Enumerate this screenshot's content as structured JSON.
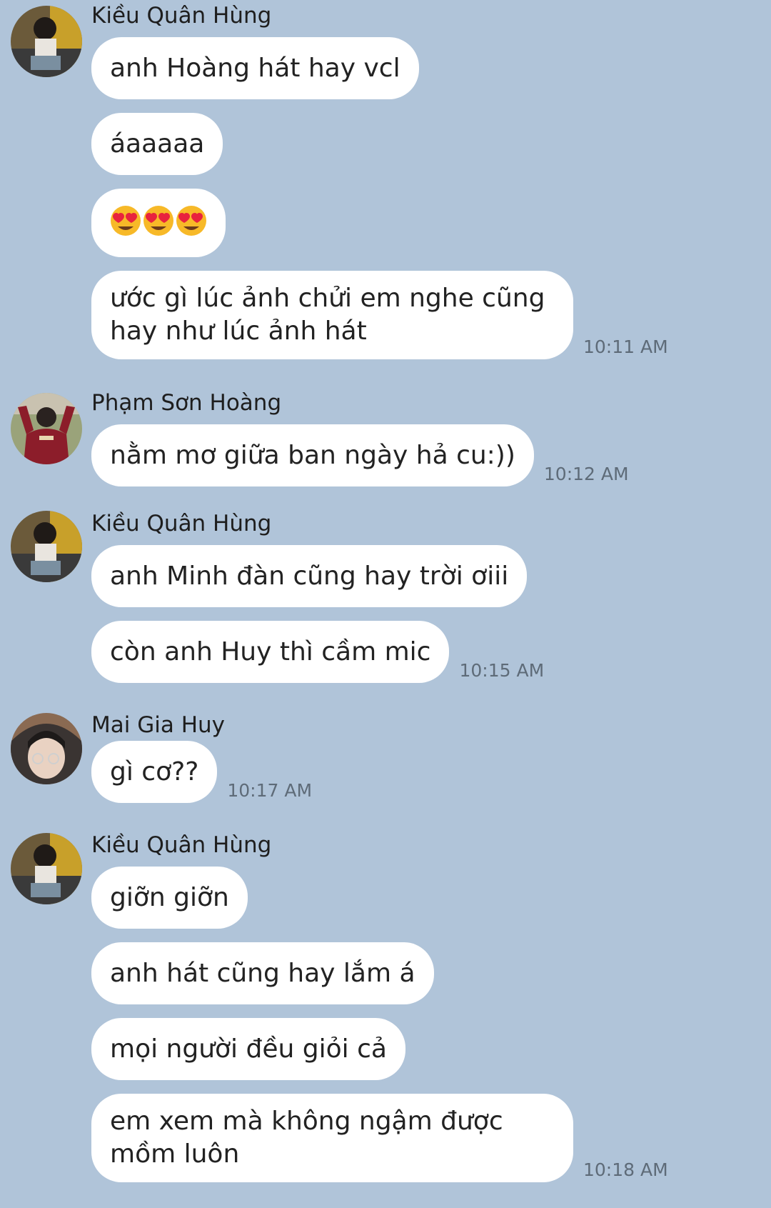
{
  "chat": {
    "groups": [
      {
        "sender": "Kiều Quân Hùng",
        "avatar_icon": "avatar-kieu-quan-hung",
        "messages": [
          {
            "text": "anh Hoàng hát hay vcl"
          },
          {
            "text": "áaaaaa"
          },
          {
            "emoji": [
              "heart-eyes-emoji",
              "heart-eyes-emoji",
              "heart-eyes-emoji"
            ]
          },
          {
            "text": "ước gì lúc ảnh chửi em nghe cũng hay như lúc ảnh hát",
            "time": "10:11 AM"
          }
        ]
      },
      {
        "sender": "Phạm Sơn Hoàng",
        "avatar_icon": "avatar-pham-son-hoang",
        "messages": [
          {
            "text": "nằm mơ giữa ban ngày hả cu:))",
            "time": "10:12 AM"
          }
        ]
      },
      {
        "sender": "Kiều Quân Hùng",
        "avatar_icon": "avatar-kieu-quan-hung",
        "messages": [
          {
            "text": "anh Minh đàn cũng hay trời ơiii"
          },
          {
            "text": "còn anh Huy thì cầm mic",
            "time": "10:15 AM"
          }
        ]
      },
      {
        "sender": "Mai Gia Huy",
        "avatar_icon": "avatar-mai-gia-huy",
        "messages": [
          {
            "text": "gì cơ??",
            "time": "10:17 AM"
          }
        ]
      },
      {
        "sender": "Kiều Quân Hùng",
        "avatar_icon": "avatar-kieu-quan-hung",
        "messages": [
          {
            "text": "giỡn giỡn"
          },
          {
            "text": "anh hát cũng hay lắm á"
          },
          {
            "text": "mọi người đều giỏi cả"
          },
          {
            "text": "em xem mà không ngậm được mồm luôn",
            "time": "10:18 AM"
          }
        ]
      }
    ]
  },
  "colors": {
    "background": "#b0c4d9",
    "bubble": "#ffffff",
    "timestamp": "#5e6b78"
  }
}
